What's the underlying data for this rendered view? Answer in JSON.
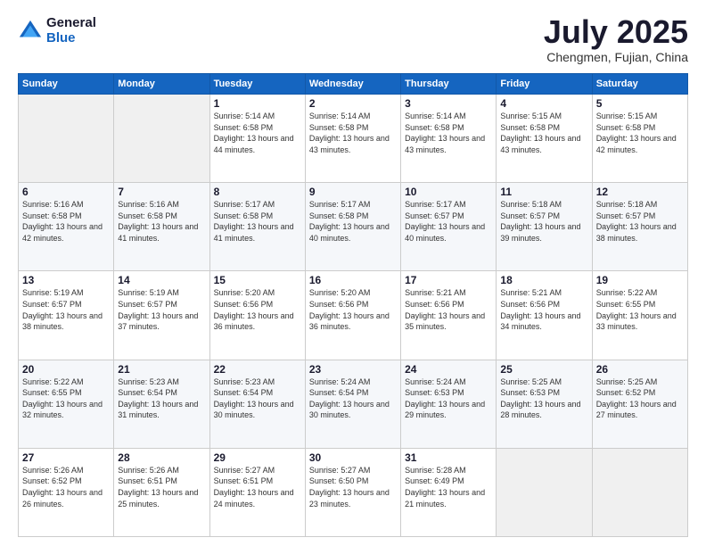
{
  "logo": {
    "general": "General",
    "blue": "Blue"
  },
  "header": {
    "month": "July 2025",
    "location": "Chengmen, Fujian, China"
  },
  "weekdays": [
    "Sunday",
    "Monday",
    "Tuesday",
    "Wednesday",
    "Thursday",
    "Friday",
    "Saturday"
  ],
  "weeks": [
    [
      null,
      null,
      {
        "day": "1",
        "sunrise": "Sunrise: 5:14 AM",
        "sunset": "Sunset: 6:58 PM",
        "daylight": "Daylight: 13 hours and 44 minutes."
      },
      {
        "day": "2",
        "sunrise": "Sunrise: 5:14 AM",
        "sunset": "Sunset: 6:58 PM",
        "daylight": "Daylight: 13 hours and 43 minutes."
      },
      {
        "day": "3",
        "sunrise": "Sunrise: 5:14 AM",
        "sunset": "Sunset: 6:58 PM",
        "daylight": "Daylight: 13 hours and 43 minutes."
      },
      {
        "day": "4",
        "sunrise": "Sunrise: 5:15 AM",
        "sunset": "Sunset: 6:58 PM",
        "daylight": "Daylight: 13 hours and 43 minutes."
      },
      {
        "day": "5",
        "sunrise": "Sunrise: 5:15 AM",
        "sunset": "Sunset: 6:58 PM",
        "daylight": "Daylight: 13 hours and 42 minutes."
      }
    ],
    [
      {
        "day": "6",
        "sunrise": "Sunrise: 5:16 AM",
        "sunset": "Sunset: 6:58 PM",
        "daylight": "Daylight: 13 hours and 42 minutes."
      },
      {
        "day": "7",
        "sunrise": "Sunrise: 5:16 AM",
        "sunset": "Sunset: 6:58 PM",
        "daylight": "Daylight: 13 hours and 41 minutes."
      },
      {
        "day": "8",
        "sunrise": "Sunrise: 5:17 AM",
        "sunset": "Sunset: 6:58 PM",
        "daylight": "Daylight: 13 hours and 41 minutes."
      },
      {
        "day": "9",
        "sunrise": "Sunrise: 5:17 AM",
        "sunset": "Sunset: 6:58 PM",
        "daylight": "Daylight: 13 hours and 40 minutes."
      },
      {
        "day": "10",
        "sunrise": "Sunrise: 5:17 AM",
        "sunset": "Sunset: 6:57 PM",
        "daylight": "Daylight: 13 hours and 40 minutes."
      },
      {
        "day": "11",
        "sunrise": "Sunrise: 5:18 AM",
        "sunset": "Sunset: 6:57 PM",
        "daylight": "Daylight: 13 hours and 39 minutes."
      },
      {
        "day": "12",
        "sunrise": "Sunrise: 5:18 AM",
        "sunset": "Sunset: 6:57 PM",
        "daylight": "Daylight: 13 hours and 38 minutes."
      }
    ],
    [
      {
        "day": "13",
        "sunrise": "Sunrise: 5:19 AM",
        "sunset": "Sunset: 6:57 PM",
        "daylight": "Daylight: 13 hours and 38 minutes."
      },
      {
        "day": "14",
        "sunrise": "Sunrise: 5:19 AM",
        "sunset": "Sunset: 6:57 PM",
        "daylight": "Daylight: 13 hours and 37 minutes."
      },
      {
        "day": "15",
        "sunrise": "Sunrise: 5:20 AM",
        "sunset": "Sunset: 6:56 PM",
        "daylight": "Daylight: 13 hours and 36 minutes."
      },
      {
        "day": "16",
        "sunrise": "Sunrise: 5:20 AM",
        "sunset": "Sunset: 6:56 PM",
        "daylight": "Daylight: 13 hours and 36 minutes."
      },
      {
        "day": "17",
        "sunrise": "Sunrise: 5:21 AM",
        "sunset": "Sunset: 6:56 PM",
        "daylight": "Daylight: 13 hours and 35 minutes."
      },
      {
        "day": "18",
        "sunrise": "Sunrise: 5:21 AM",
        "sunset": "Sunset: 6:56 PM",
        "daylight": "Daylight: 13 hours and 34 minutes."
      },
      {
        "day": "19",
        "sunrise": "Sunrise: 5:22 AM",
        "sunset": "Sunset: 6:55 PM",
        "daylight": "Daylight: 13 hours and 33 minutes."
      }
    ],
    [
      {
        "day": "20",
        "sunrise": "Sunrise: 5:22 AM",
        "sunset": "Sunset: 6:55 PM",
        "daylight": "Daylight: 13 hours and 32 minutes."
      },
      {
        "day": "21",
        "sunrise": "Sunrise: 5:23 AM",
        "sunset": "Sunset: 6:54 PM",
        "daylight": "Daylight: 13 hours and 31 minutes."
      },
      {
        "day": "22",
        "sunrise": "Sunrise: 5:23 AM",
        "sunset": "Sunset: 6:54 PM",
        "daylight": "Daylight: 13 hours and 30 minutes."
      },
      {
        "day": "23",
        "sunrise": "Sunrise: 5:24 AM",
        "sunset": "Sunset: 6:54 PM",
        "daylight": "Daylight: 13 hours and 30 minutes."
      },
      {
        "day": "24",
        "sunrise": "Sunrise: 5:24 AM",
        "sunset": "Sunset: 6:53 PM",
        "daylight": "Daylight: 13 hours and 29 minutes."
      },
      {
        "day": "25",
        "sunrise": "Sunrise: 5:25 AM",
        "sunset": "Sunset: 6:53 PM",
        "daylight": "Daylight: 13 hours and 28 minutes."
      },
      {
        "day": "26",
        "sunrise": "Sunrise: 5:25 AM",
        "sunset": "Sunset: 6:52 PM",
        "daylight": "Daylight: 13 hours and 27 minutes."
      }
    ],
    [
      {
        "day": "27",
        "sunrise": "Sunrise: 5:26 AM",
        "sunset": "Sunset: 6:52 PM",
        "daylight": "Daylight: 13 hours and 26 minutes."
      },
      {
        "day": "28",
        "sunrise": "Sunrise: 5:26 AM",
        "sunset": "Sunset: 6:51 PM",
        "daylight": "Daylight: 13 hours and 25 minutes."
      },
      {
        "day": "29",
        "sunrise": "Sunrise: 5:27 AM",
        "sunset": "Sunset: 6:51 PM",
        "daylight": "Daylight: 13 hours and 24 minutes."
      },
      {
        "day": "30",
        "sunrise": "Sunrise: 5:27 AM",
        "sunset": "Sunset: 6:50 PM",
        "daylight": "Daylight: 13 hours and 23 minutes."
      },
      {
        "day": "31",
        "sunrise": "Sunrise: 5:28 AM",
        "sunset": "Sunset: 6:49 PM",
        "daylight": "Daylight: 13 hours and 21 minutes."
      },
      null,
      null
    ]
  ]
}
